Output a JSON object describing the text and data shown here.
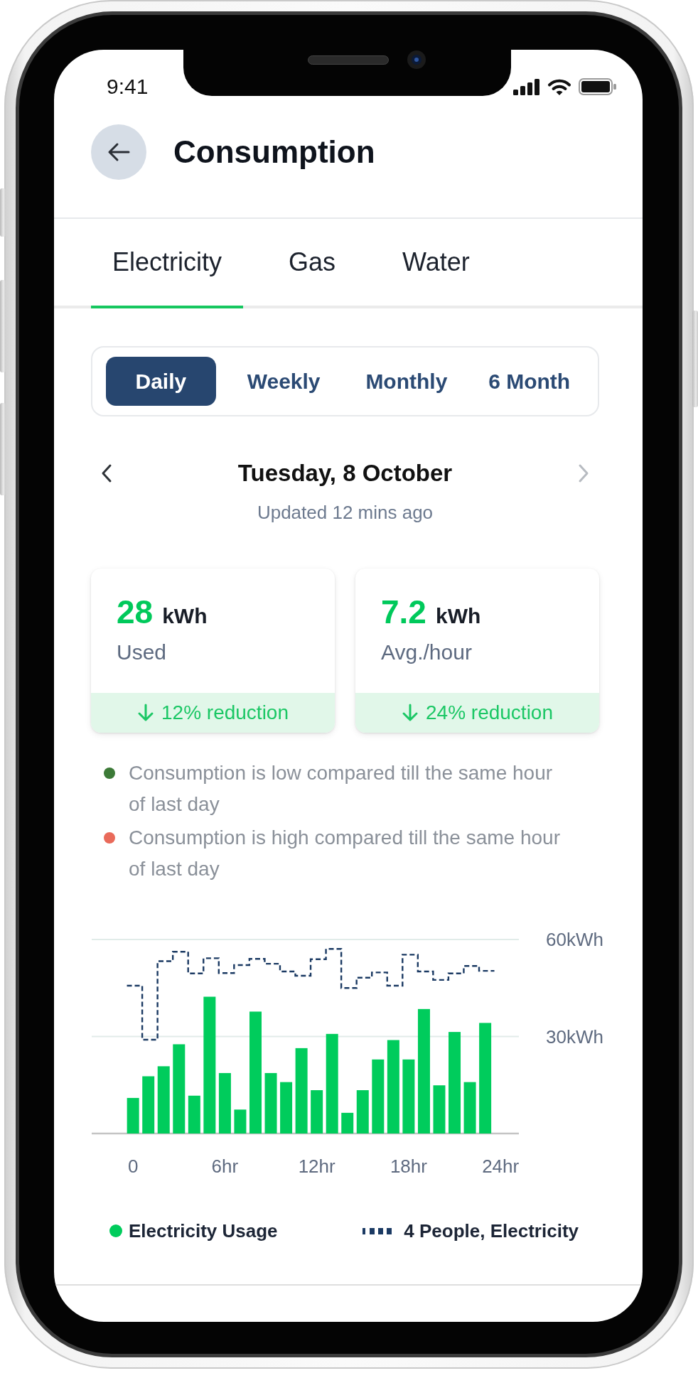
{
  "status_bar": {
    "time": "9:41"
  },
  "header": {
    "title": "Consumption"
  },
  "tabs": [
    {
      "label": "Electricity",
      "selected": true
    },
    {
      "label": "Gas",
      "selected": false
    },
    {
      "label": "Water",
      "selected": false
    }
  ],
  "periods": [
    {
      "label": "Daily",
      "selected": true
    },
    {
      "label": "Weekly",
      "selected": false
    },
    {
      "label": "Monthly",
      "selected": false
    },
    {
      "label": "6 Month",
      "selected": false
    }
  ],
  "date_nav": {
    "date": "Tuesday, 8 October",
    "updated": "Updated 12 mins ago",
    "previous": {
      "disabled": false
    },
    "next": {
      "disabled": true
    }
  },
  "stats": [
    {
      "value": "28",
      "unit": "kWh",
      "label": "Used",
      "change": "12% reduction",
      "decrease": true
    },
    {
      "value": "7.2",
      "unit": "kWh",
      "label": "Avg./hour",
      "change": "24% reduction",
      "decrease": true
    }
  ],
  "notes": [
    {
      "text": "Consumption is low compared till the same hour of last day",
      "color": "#3c7a37"
    },
    {
      "text": "Consumption is high compared till the same hour of last day",
      "color": "#e96a5a"
    }
  ],
  "chart": {
    "chart_data": {
      "type": "bar",
      "x": [
        0,
        1,
        2,
        3,
        4,
        5,
        6,
        7,
        8,
        9,
        10,
        11,
        12,
        13,
        14,
        15,
        16,
        17,
        18,
        19,
        20,
        21,
        22,
        23
      ],
      "xlim": [
        -2.7,
        25.2
      ],
      "ylim": [
        0,
        60
      ],
      "xticks": [
        {
          "value": 0,
          "label": "0"
        },
        {
          "value": 6,
          "label": "6hr"
        },
        {
          "value": 12,
          "label": "12hr"
        },
        {
          "value": 18,
          "label": "18hr"
        },
        {
          "value": 24,
          "label": "24hr"
        }
      ],
      "yticks": [
        {
          "value": 30,
          "label": "30kWh"
        },
        {
          "value": 60,
          "label": "60kWh"
        }
      ],
      "legend": "bottom",
      "series": [
        {
          "name": "Electricity Usage",
          "color": "#00cc5c",
          "values": [
            11.0,
            17.7,
            20.8,
            27.6,
            11.7,
            42.3,
            18.7,
            7.4,
            37.7,
            18.7,
            15.9,
            26.4,
            13.4,
            30.8,
            6.4,
            13.4,
            22.9,
            28.9,
            22.9,
            38.5,
            14.9,
            31.4,
            15.9,
            34.2
          ]
        },
        {
          "name": "4 People, Electricity",
          "type": "line",
          "line_style": "dashed",
          "color": "#1b3a63",
          "x": [
            -0.4,
            0.6,
            0.6,
            1.6,
            1.6,
            2.6,
            2.6,
            3.6,
            3.6,
            4.6,
            4.6,
            5.6,
            5.6,
            6.6,
            6.6,
            7.6,
            7.6,
            8.6,
            8.6,
            9.6,
            9.6,
            10.6,
            10.6,
            11.6,
            11.6,
            12.6,
            12.6,
            13.6,
            13.6,
            14.6,
            14.6,
            15.6,
            15.6,
            16.6,
            16.6,
            17.6,
            17.6,
            18.6,
            18.6,
            19.6,
            19.6,
            20.6,
            20.6,
            21.6,
            21.6,
            22.6,
            22.6,
            23.6
          ],
          "values": [
            45.7,
            45.7,
            29.0,
            29.0,
            53.3,
            53.3,
            56.2,
            56.2,
            49.5,
            49.5,
            54.2,
            54.2,
            49.6,
            49.6,
            52.1,
            52.1,
            54.0,
            54.0,
            52.5,
            52.5,
            50.1,
            50.1,
            48.8,
            48.8,
            53.9,
            53.9,
            57.1,
            57.1,
            45.0,
            45.0,
            48.2,
            48.2,
            49.8,
            49.8,
            45.7,
            45.7,
            55.3,
            55.3,
            50.1,
            50.1,
            47.5,
            47.5,
            49.5,
            49.5,
            51.8,
            51.8,
            50.3,
            50.3
          ]
        }
      ]
    }
  }
}
